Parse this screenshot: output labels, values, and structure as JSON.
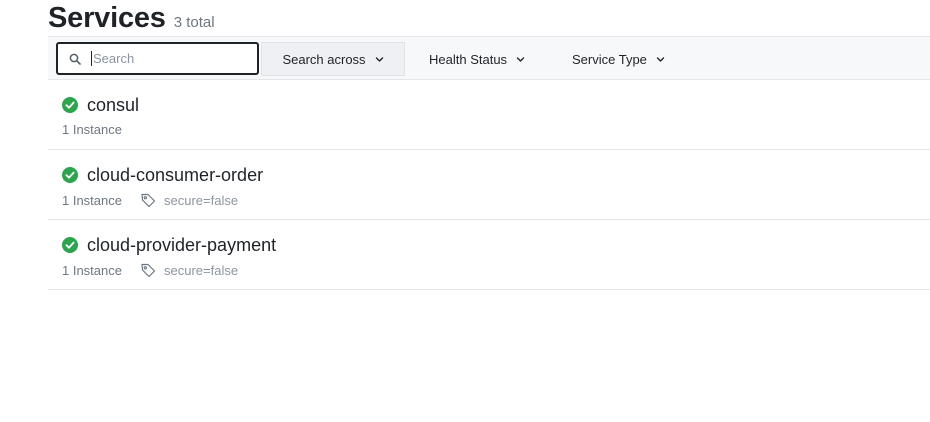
{
  "header": {
    "title": "Services",
    "count_label": "3 total"
  },
  "filters": {
    "search_placeholder": "Search",
    "search_value": "",
    "search_across_label": "Search across",
    "health_status_label": "Health Status",
    "service_type_label": "Service Type"
  },
  "services": [
    {
      "name": "consul",
      "status": "passing",
      "instances": "1 Instance",
      "tag": ""
    },
    {
      "name": "cloud-consumer-order",
      "status": "passing",
      "instances": "1 Instance",
      "tag": "secure=false"
    },
    {
      "name": "cloud-provider-payment",
      "status": "passing",
      "instances": "1 Instance",
      "tag": "secure=false"
    }
  ],
  "icons": {
    "search": "search-icon",
    "chevron": "chevron-down-icon",
    "status": "check-circle-icon",
    "tag": "tag-icon"
  },
  "colors": {
    "passing": "#2ea44f",
    "text": "#1f2328",
    "muted": "#6e7781"
  }
}
